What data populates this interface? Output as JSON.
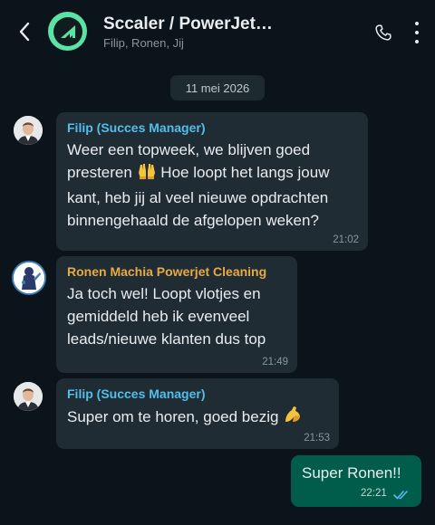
{
  "header": {
    "title": "Sccaler / PowerJet…",
    "subtitle": "Filip, Ronen, Jij"
  },
  "date_separator": "11 mei 2026",
  "messages": [
    {
      "sender": "Filip (Succes Manager)",
      "sender_color": "#53bdeb",
      "lines": [
        "Weer een topweek, we blijven goed",
        "presteren",
        "Hoe loopt het langs jouw",
        "kant, heb jij al veel nieuwe opdrachten",
        "binnengehaald de afgelopen weken?"
      ],
      "time": "21:02"
    },
    {
      "sender": "Ronen Machia Powerjet Cleaning",
      "sender_color": "#e9a943",
      "lines": [
        "Ja toch wel! Loopt vlotjes en",
        "gemiddeld heb ik evenveel",
        "leads/nieuwe klanten dus top"
      ],
      "time": "21:49"
    },
    {
      "sender": "Filip (Succes Manager)",
      "sender_color": "#53bdeb",
      "lines": [
        "Super om te horen, goed bezig"
      ],
      "time": "21:53"
    }
  ],
  "outgoing": {
    "text": "Super Ronen!!",
    "time": "22:21"
  },
  "colors": {
    "background": "#0b141a",
    "incoming_bubble": "#1f2c34",
    "outgoing_bubble": "#005c4b",
    "read_ticks": "#53bdeb",
    "group_avatar": "#5be3a5"
  }
}
